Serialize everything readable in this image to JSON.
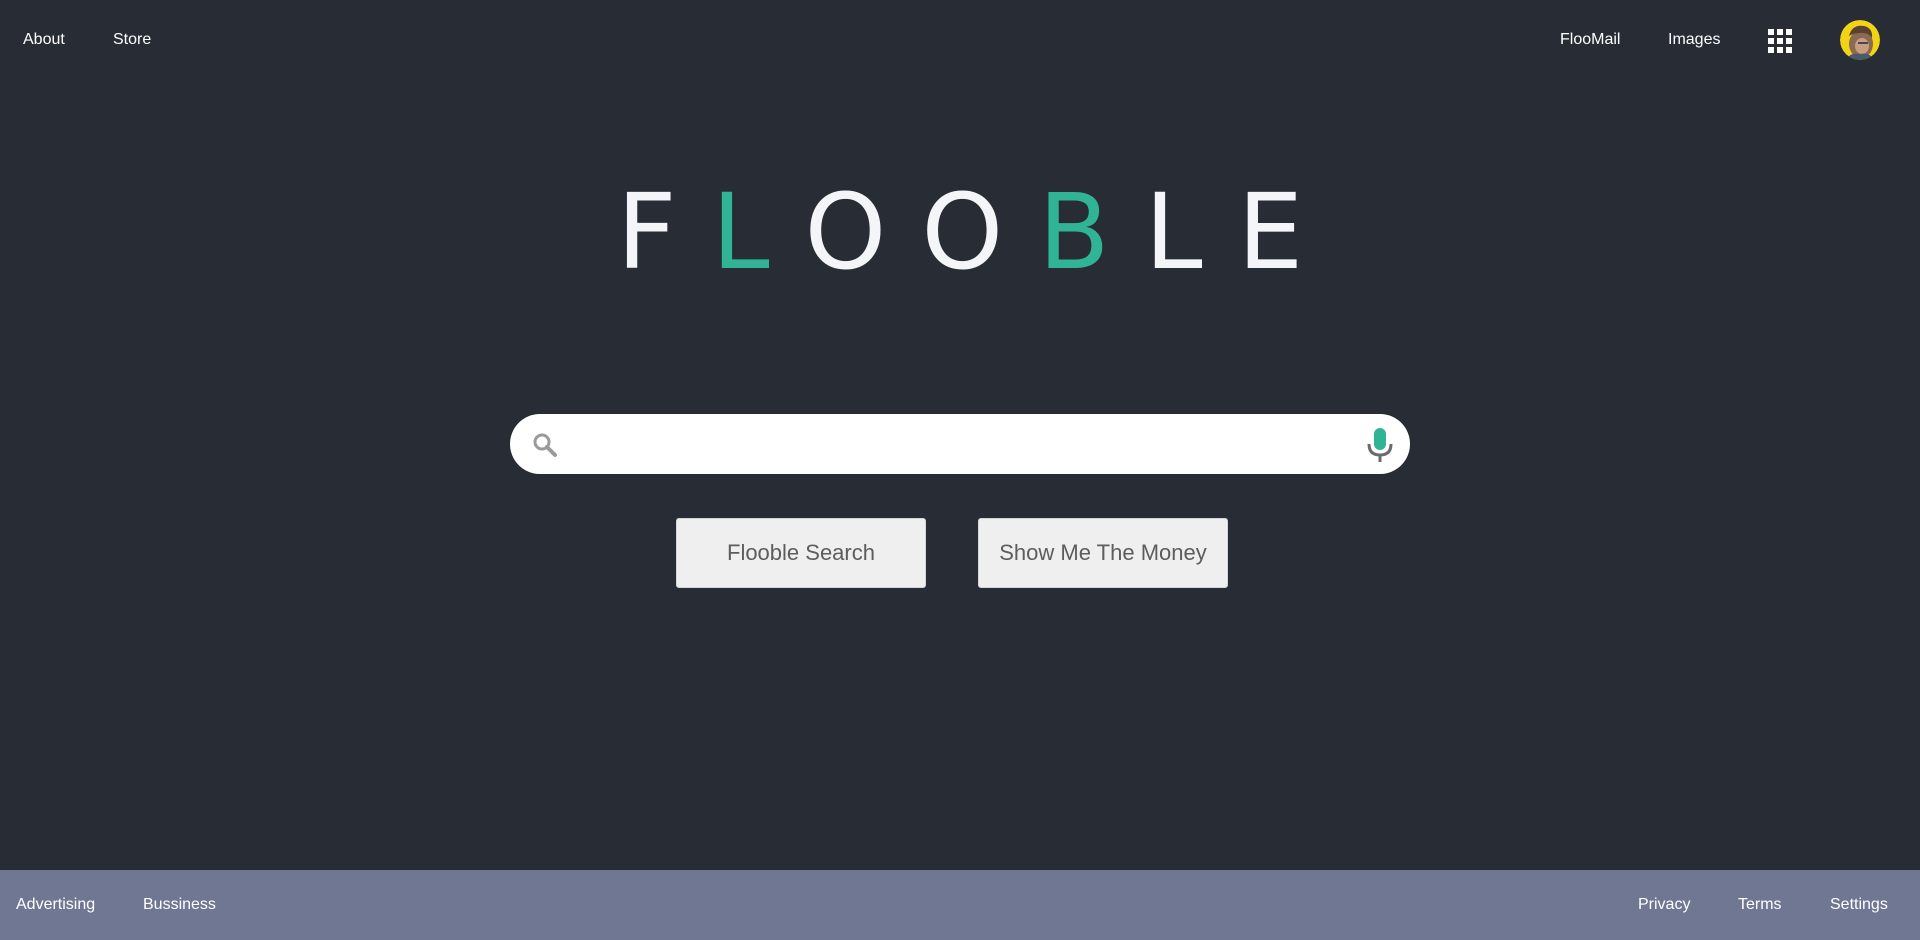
{
  "nav": {
    "left": [
      "About",
      "Store"
    ],
    "right": [
      "FlooMail",
      "Images"
    ],
    "apps_icon": "grid-icon",
    "avatar": "user-avatar"
  },
  "logo": {
    "letters": [
      "F",
      "L",
      "O",
      "O",
      "B",
      "L",
      "E"
    ],
    "accent_color": "#30b495",
    "base_color": "#f4f5f8"
  },
  "search": {
    "value": "",
    "placeholder": "",
    "search_icon": "search-icon",
    "mic_icon": "microphone-icon"
  },
  "buttons": {
    "search_label": "Flooble Search",
    "lucky_label": "Show Me The Money"
  },
  "footer": {
    "left": [
      "Advertising",
      "Bussiness"
    ],
    "right": [
      "Privacy",
      "Terms",
      "Settings"
    ]
  },
  "colors": {
    "background": "#282c35",
    "footer": "#707792",
    "accent": "#30b495"
  }
}
